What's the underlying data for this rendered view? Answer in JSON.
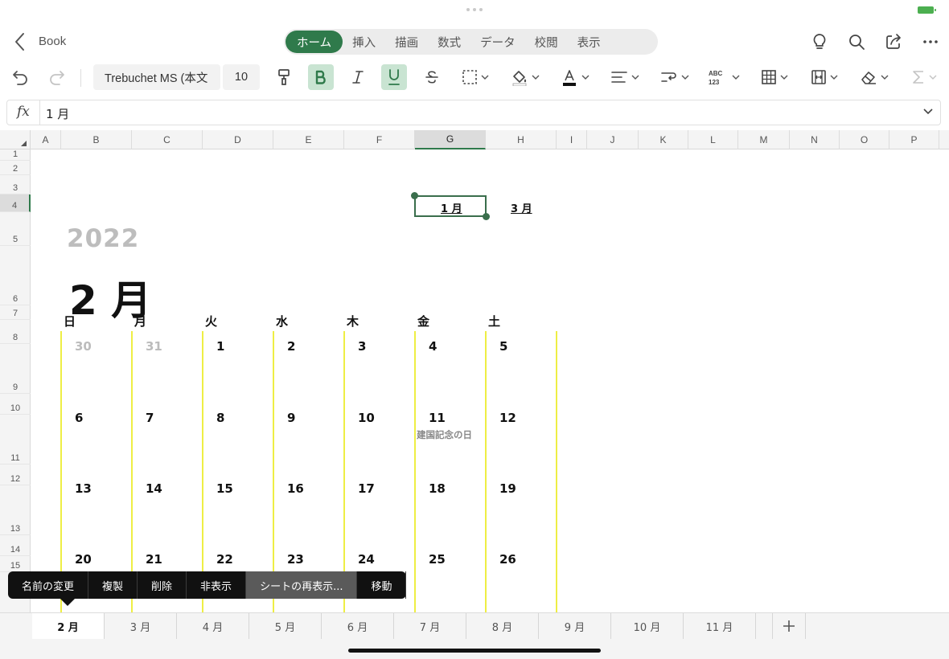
{
  "app": {
    "book_title": "Book",
    "ribbon_tabs": [
      "ホーム",
      "挿入",
      "描画",
      "数式",
      "データ",
      "校閲",
      "表示"
    ],
    "active_tab": "ホーム",
    "title_icons": [
      "lightbulb-icon",
      "search-icon",
      "share-icon",
      "more-icon"
    ]
  },
  "toolbar": {
    "font_name": "Trebuchet MS (本文",
    "font_size": "10",
    "bold_active": true,
    "underline_active": true,
    "autosum_disabled": true
  },
  "formula_bar": {
    "fx_label": "fx",
    "value": "1 月"
  },
  "grid": {
    "columns": [
      "A",
      "B",
      "C",
      "D",
      "E",
      "F",
      "G",
      "H",
      "I",
      "J",
      "K",
      "L",
      "M",
      "N",
      "O",
      "P"
    ],
    "selected_column": "G",
    "rows": [
      "1",
      "2",
      "3",
      "4",
      "5",
      "6",
      "7",
      "8",
      "9",
      "10",
      "11",
      "12",
      "13",
      "14",
      "15"
    ],
    "selected_row": "4"
  },
  "calendar": {
    "prev_month_link": "1 月",
    "next_month_link": "3 月",
    "year": "2022",
    "month": "2 月",
    "weekdays": [
      "日",
      "月",
      "火",
      "水",
      "木",
      "金",
      "土"
    ],
    "weeks": [
      [
        {
          "d": "30",
          "dim": true
        },
        {
          "d": "31",
          "dim": true
        },
        {
          "d": "1"
        },
        {
          "d": "2"
        },
        {
          "d": "3"
        },
        {
          "d": "4"
        },
        {
          "d": "5"
        }
      ],
      [
        {
          "d": "6"
        },
        {
          "d": "7"
        },
        {
          "d": "8"
        },
        {
          "d": "9"
        },
        {
          "d": "10"
        },
        {
          "d": "11",
          "note": "建国記念の日"
        },
        {
          "d": "12"
        }
      ],
      [
        {
          "d": "13"
        },
        {
          "d": "14"
        },
        {
          "d": "15"
        },
        {
          "d": "16"
        },
        {
          "d": "17"
        },
        {
          "d": "18"
        },
        {
          "d": "19"
        }
      ],
      [
        {
          "d": "20"
        },
        {
          "d": "21"
        },
        {
          "d": "22"
        },
        {
          "d": "23"
        },
        {
          "d": "24"
        },
        {
          "d": "25"
        },
        {
          "d": "26"
        }
      ]
    ],
    "line_color": "#eeee44"
  },
  "context_menu": {
    "items": [
      "名前の変更",
      "複製",
      "削除",
      "非表示",
      "シートの再表示...",
      "移動"
    ],
    "highlighted": "シートの再表示..."
  },
  "sheet_tabs": {
    "tabs": [
      "2 月",
      "3 月",
      "4 月",
      "5 月",
      "6 月",
      "7 月",
      "8 月",
      "9 月",
      "10 月",
      "11 月"
    ],
    "active": "2 月",
    "add_label": "+"
  },
  "colors": {
    "accent": "#2f7a4b",
    "selection": "#3a6e4c"
  }
}
